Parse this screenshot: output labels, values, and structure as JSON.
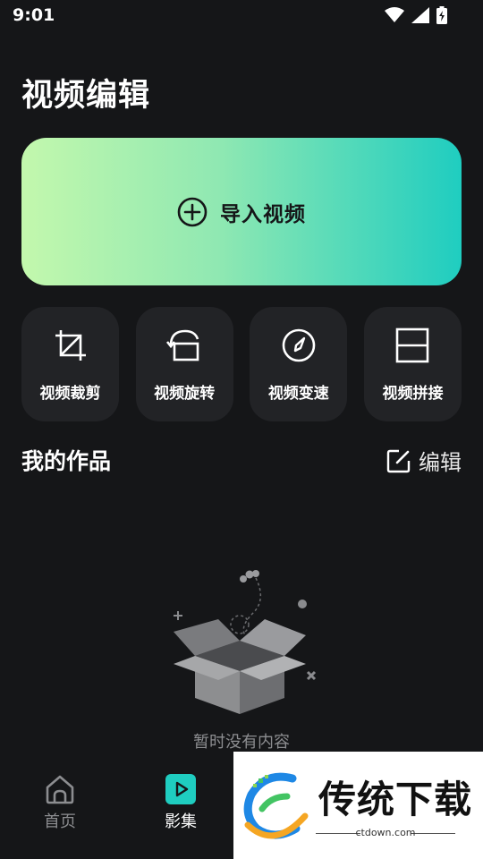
{
  "status_bar": {
    "time": "9:01",
    "icons": [
      "wifi-icon",
      "signal-icon",
      "battery-charging-icon"
    ]
  },
  "page": {
    "title": "视频编辑"
  },
  "import": {
    "label": "导入视频",
    "icon": "plus-circle-icon",
    "gradient": [
      "#c3f8ad",
      "#1fcdc0"
    ]
  },
  "tools": [
    {
      "label": "视频裁剪",
      "icon": "crop-icon"
    },
    {
      "label": "视频旋转",
      "icon": "rotate-icon"
    },
    {
      "label": "视频变速",
      "icon": "speed-gauge-icon"
    },
    {
      "label": "视频拼接",
      "icon": "split-layout-icon"
    }
  ],
  "works": {
    "title": "我的作品",
    "edit_label": "编辑",
    "empty_text": "暂时没有内容"
  },
  "tabbar": {
    "items": [
      {
        "label": "首页",
        "icon": "home-icon",
        "active": false
      },
      {
        "label": "影集",
        "icon": "play-square-icon",
        "active": true
      }
    ]
  },
  "watermark": {
    "brand": "传统下载",
    "url": "ctdown.com"
  },
  "colors": {
    "background": "#151618",
    "card": "#222326",
    "accent": "#1fcdc0",
    "muted": "#8c8d90"
  }
}
